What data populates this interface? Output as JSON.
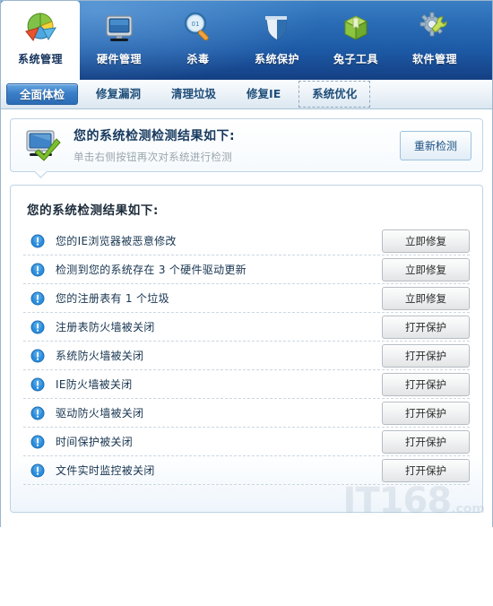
{
  "topnav": {
    "items": [
      {
        "label": "系统管理",
        "icon": "pie-chart-icon",
        "active": true
      },
      {
        "label": "硬件管理",
        "icon": "monitor-icon",
        "active": false
      },
      {
        "label": "杀毒",
        "icon": "magnifier-icon",
        "active": false
      },
      {
        "label": "系统保护",
        "icon": "shield-icon",
        "active": false
      },
      {
        "label": "兔子工具",
        "icon": "green-box-icon",
        "active": false
      },
      {
        "label": "软件管理",
        "icon": "gear-wrench-icon",
        "active": false
      }
    ]
  },
  "tabs": [
    {
      "label": "全面体检",
      "state": "active"
    },
    {
      "label": "修复漏洞",
      "state": "normal"
    },
    {
      "label": "清理垃圾",
      "state": "normal"
    },
    {
      "label": "修复IE",
      "state": "normal"
    },
    {
      "label": "系统优化",
      "state": "dashed"
    }
  ],
  "summary": {
    "icon": "monitor-check-icon",
    "title": "您的系统检测检测结果如下:",
    "subtitle": "单击右侧按钮再次对系统进行检测",
    "rescan_label": "重新检测"
  },
  "results": {
    "title": "您的系统检测结果如下:",
    "rows": [
      {
        "icon": "warning-icon",
        "message": "您的IE浏览器被恶意修改",
        "action": "立即修复"
      },
      {
        "icon": "warning-icon",
        "message": "检测到您的系统存在 3 个硬件驱动更新",
        "action": "立即修复"
      },
      {
        "icon": "warning-icon",
        "message": "您的注册表有 1 个垃圾",
        "action": "立即修复"
      },
      {
        "icon": "warning-icon",
        "message": "注册表防火墙被关闭",
        "action": "打开保护"
      },
      {
        "icon": "warning-icon",
        "message": "系统防火墙被关闭",
        "action": "打开保护"
      },
      {
        "icon": "warning-icon",
        "message": "IE防火墙被关闭",
        "action": "打开保护"
      },
      {
        "icon": "warning-icon",
        "message": "驱动防火墙被关闭",
        "action": "打开保护"
      },
      {
        "icon": "warning-icon",
        "message": "时间保护被关闭",
        "action": "打开保护"
      },
      {
        "icon": "warning-icon",
        "message": "文件实时监控被关闭",
        "action": "打开保护"
      }
    ]
  },
  "watermark": {
    "text": "IT168",
    "suffix": ".com"
  },
  "colors": {
    "nav_blue": "#1d5aa6",
    "tab_active": "#3b7fc8",
    "panel_border": "#bfd4e6",
    "warning_blue": "#2b8ede",
    "text_dark": "#17344f"
  }
}
